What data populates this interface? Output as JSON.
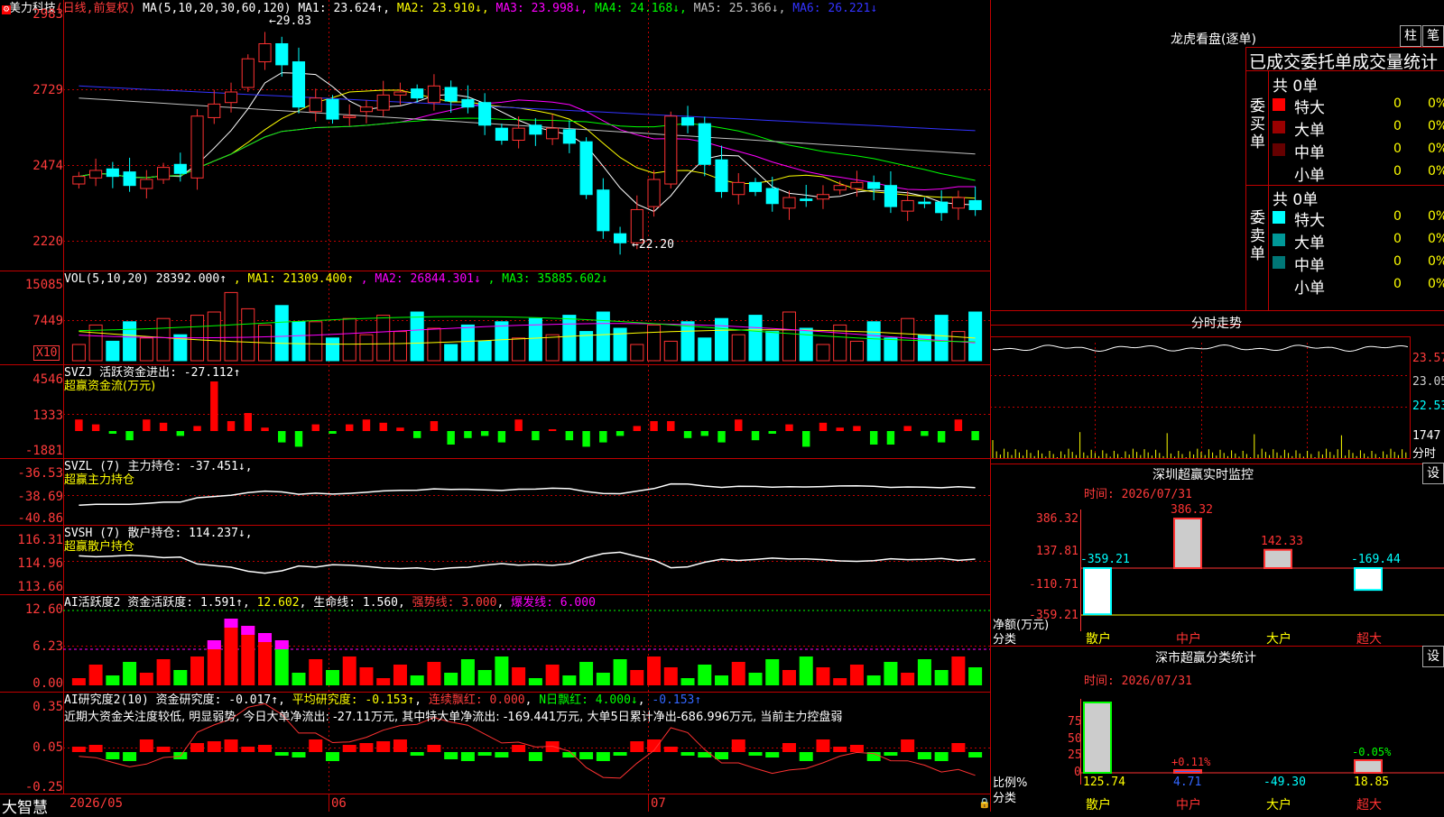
{
  "stock": {
    "name": "美力科技",
    "period_label": "(日线,前复权)",
    "ma_label": "MA(5,10,20,30,60,120)",
    "ma": [
      {
        "k": "MA1:",
        "v": "23.624↑",
        "c": "#ffffff"
      },
      {
        "k": "MA2:",
        "v": "23.910↓",
        "c": "#ffff00"
      },
      {
        "k": "MA3:",
        "v": "23.998↓",
        "c": "#ff00ff"
      },
      {
        "k": "MA4:",
        "v": "24.168↓",
        "c": "#00ff00"
      },
      {
        "k": "MA5:",
        "v": "25.366↓",
        "c": "#c0c0c0"
      },
      {
        "k": "MA6:",
        "v": "26.221↓",
        "c": "#3333ff"
      }
    ],
    "price_axis": [
      "2983",
      "2729",
      "2474",
      "2220"
    ],
    "high_mark": "29.83",
    "low_mark": "22.20"
  },
  "vol": {
    "label": "VOL(5,10,20)",
    "value": "28392.000↑",
    "ma": [
      {
        "k": "MA1:",
        "v": "21309.400↑",
        "c": "#ffff00"
      },
      {
        "k": "MA2:",
        "v": "26844.301↓",
        "c": "#ff00ff"
      },
      {
        "k": "MA3:",
        "v": "35885.602↓",
        "c": "#00ff00"
      }
    ],
    "axis": [
      "15085",
      "7449"
    ],
    "unit": "X10"
  },
  "svzj": {
    "label": "SVZJ  活跃资金进出:",
    "value": "-27.112↑",
    "sub": "超赢资金流(万元)",
    "axis": [
      "4546",
      "1333",
      "-1881"
    ]
  },
  "svzl": {
    "label": "SVZL (7) 主力持仓:",
    "value": "-37.451↓,",
    "sub": "超赢主力持仓",
    "axis": [
      "-36.53",
      "-38.69",
      "-40.86"
    ]
  },
  "svsh": {
    "label": "SVSH (7) 散户持仓:",
    "value": "114.237↓,",
    "sub": "超赢散户持仓",
    "axis": [
      "116.31",
      "114.96",
      "113.66"
    ]
  },
  "ai1": {
    "label": "AI活跃度2 资金活跃度:",
    "value": "1.591↑",
    "v2": "12.602",
    "life": "生命线: 1.560",
    "strong": "强势线: 3.000",
    "burst": "爆发线: 6.000",
    "axis": [
      "12.60",
      "6.23",
      "0.00"
    ]
  },
  "ai2": {
    "label": "AI研究度2(10) 资金研究度:",
    "value": "-0.017↑",
    "avg": "平均研究度: -0.153↑",
    "red": "连续飘红: 0.000",
    "nred": "N日飘红: 4.000↓",
    "last": "-0.153↑",
    "axis": [
      "0.35",
      "0.05",
      "-0.25"
    ],
    "comment": "近期大资金关注度较低, 明显弱势, 今日大单净流出: -27.11万元, 其中特大单净流出: -169.441万元, 大单5日累计净出-686.996万元, 当前主力控盘弱"
  },
  "bottom": {
    "brand": "大智慧",
    "dates": [
      "2026/05",
      "06",
      "07"
    ]
  },
  "right": {
    "lhb_title": "龙虎看盘(逐单)",
    "btn1": "柱",
    "btn2": "笔",
    "header": "已成交委托单成交量统计",
    "buy": {
      "side": "委买单",
      "total": "共 0单",
      "rows": [
        {
          "n": "特大",
          "c": "#ff0000",
          "q": "0",
          "p": "0%"
        },
        {
          "n": "大单",
          "c": "#990000",
          "q": "0",
          "p": "0%"
        },
        {
          "n": "中单",
          "c": "#660000",
          "q": "0",
          "p": "0%"
        },
        {
          "n": "小单",
          "c": "",
          "q": "0",
          "p": "0%"
        }
      ]
    },
    "sell": {
      "side": "委卖单",
      "total": "共 0单",
      "rows": [
        {
          "n": "特大",
          "c": "#00ffff",
          "q": "0",
          "p": "0%"
        },
        {
          "n": "大单",
          "c": "#009999",
          "q": "0",
          "p": "0%"
        },
        {
          "n": "中单",
          "c": "#007777",
          "q": "0",
          "p": "0%"
        },
        {
          "n": "小单",
          "c": "",
          "q": "0",
          "p": "0%"
        }
      ]
    },
    "fs_title": "分时走势",
    "fs_axis": [
      "23.57",
      "23.05",
      "22.53",
      "1747",
      "分时"
    ],
    "sz_title": "深圳超赢实时监控",
    "set": "设",
    "time1": "时间: 2026/07/31",
    "sz_axis": [
      "386.32",
      "137.81",
      "-110.71",
      "-359.21"
    ],
    "sz_vals": [
      {
        "cat": "散户",
        "v": -359.21,
        "lab": "-359.21"
      },
      {
        "cat": "中户",
        "v": 386.32,
        "lab": "386.32"
      },
      {
        "cat": "大户",
        "v": 142.33,
        "lab": "142.33"
      },
      {
        "cat": "超大",
        "v": -169.44,
        "lab": "-169.44"
      }
    ],
    "net_label": "净额(万元)",
    "cat_label": "分类",
    "ss_title": "深市超赢分类统计",
    "time2": "时间: 2026/07/31",
    "ss_axis": [
      "75",
      "50",
      "25",
      "0"
    ],
    "ss_vals": [
      {
        "cat": "散户",
        "v": "125.74",
        "top": ""
      },
      {
        "cat": "中户",
        "v": "4.71",
        "top": "+0.11%"
      },
      {
        "cat": "大户",
        "v": "-49.30",
        "top": ""
      },
      {
        "cat": "超大",
        "v": "18.85",
        "top": "-0.05%"
      }
    ],
    "ratio_label": "比例%",
    "cat_label2": "分类"
  },
  "chart_data": {
    "type": "candlestick",
    "title": "美力科技 日线",
    "dates": [
      "2026/05",
      "06",
      "07"
    ],
    "price_range": [
      22.2,
      29.83
    ],
    "closes": [
      24.6,
      24.8,
      24.6,
      24.3,
      24.5,
      24.9,
      24.7,
      26.6,
      27.0,
      27.4,
      28.5,
      29.0,
      28.3,
      26.9,
      27.2,
      26.5,
      26.6,
      26.9,
      27.3,
      27.4,
      27.2,
      27.6,
      27.1,
      26.9,
      26.3,
      25.8,
      26.2,
      26.0,
      26.2,
      25.7,
      24.0,
      22.8,
      22.4,
      23.5,
      24.5,
      26.6,
      26.3,
      25.0,
      24.1,
      24.4,
      24.1,
      23.7,
      23.9,
      23.8,
      24.0,
      24.3,
      24.4,
      24.2,
      23.6,
      23.8,
      23.7,
      23.4,
      23.9,
      23.5
    ]
  }
}
